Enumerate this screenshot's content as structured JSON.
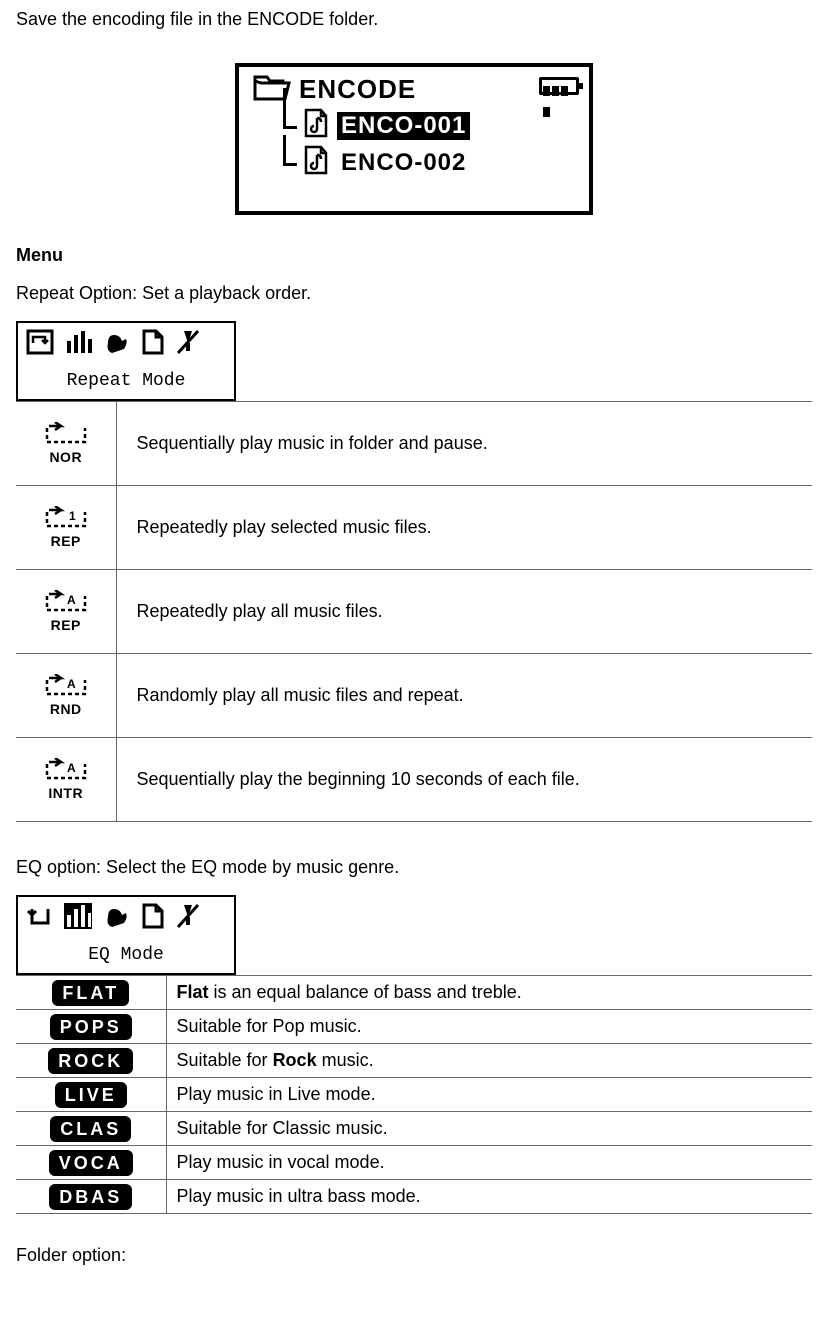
{
  "intro": "Save the encoding file in the ENCODE folder.",
  "encode_screen": {
    "folder_label": "ENCODE",
    "files": [
      "ENCO-001",
      "ENCO-002"
    ],
    "selected_index": 0
  },
  "menu_heading": "Menu",
  "repeat": {
    "intro": "Repeat Option: Set a playback order.",
    "box_caption": "Repeat Mode",
    "rows": [
      {
        "icon_label": "NOR",
        "desc": "Sequentially play music in folder and pause."
      },
      {
        "icon_label": "REP",
        "desc": "Repeatedly play selected music files."
      },
      {
        "icon_label": "REP",
        "desc": "Repeatedly play all music files."
      },
      {
        "icon_label": "RND",
        "desc": "Randomly play all music files and repeat."
      },
      {
        "icon_label": "INTR",
        "desc": "Sequentially play the beginning 10 seconds of each file."
      }
    ]
  },
  "eq": {
    "intro": "EQ option: Select the EQ mode by music genre.",
    "box_caption": "EQ Mode",
    "rows": [
      {
        "pill": "FLAT",
        "desc_pre": "",
        "bold": "Flat",
        "desc_post": " is an equal balance of bass and treble."
      },
      {
        "pill": "POPS",
        "desc_pre": "Suitable for Pop music.",
        "bold": "",
        "desc_post": ""
      },
      {
        "pill": "ROCK",
        "desc_pre": "Suitable for ",
        "bold": "Rock",
        "desc_post": " music."
      },
      {
        "pill": "LIVE",
        "desc_pre": "Play music in Live mode.",
        "bold": "",
        "desc_post": ""
      },
      {
        "pill": "CLAS",
        "desc_pre": "Suitable for Classic music.",
        "bold": "",
        "desc_post": ""
      },
      {
        "pill": "VOCA",
        "desc_pre": "Play music in vocal mode.",
        "bold": "",
        "desc_post": ""
      },
      {
        "pill": "DBAS",
        "desc_pre": "Play music in ultra bass mode.",
        "bold": "",
        "desc_post": ""
      }
    ]
  },
  "folder_option_label": "Folder option:"
}
